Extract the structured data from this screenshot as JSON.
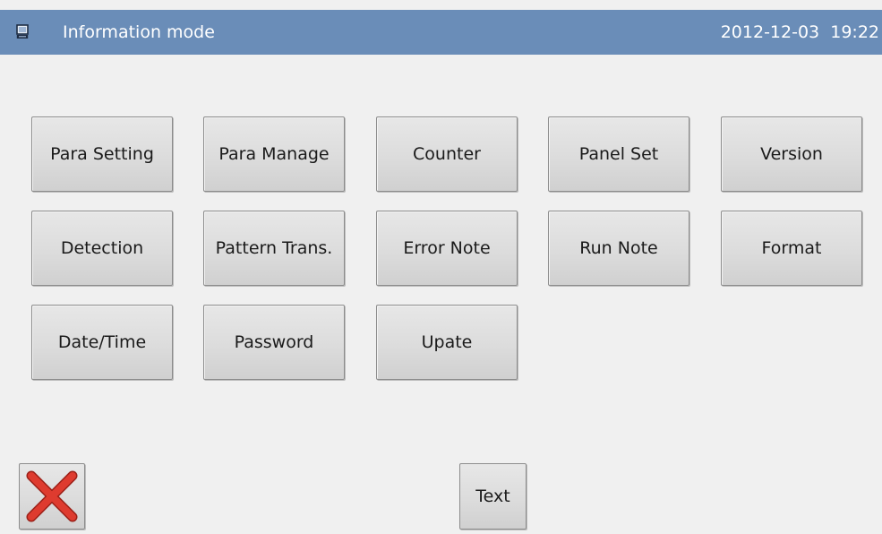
{
  "title_bar": {
    "title": "Information mode",
    "date": "2012-12-03",
    "time": "19:22",
    "icon": "monitor-icon",
    "background_color": "#6a8db8"
  },
  "menu": {
    "buttons": [
      {
        "label": "Para Setting"
      },
      {
        "label": "Para Manage"
      },
      {
        "label": "Counter"
      },
      {
        "label": "Panel Set"
      },
      {
        "label": "Version"
      },
      {
        "label": "Detection"
      },
      {
        "label": "Pattern Trans."
      },
      {
        "label": "Error Note"
      },
      {
        "label": "Run Note"
      },
      {
        "label": "Format"
      },
      {
        "label": "Date/Time"
      },
      {
        "label": "Password"
      },
      {
        "label": "Upate"
      }
    ]
  },
  "footer": {
    "close_icon": "close-icon",
    "close_color": "#d83a2e",
    "text_button_label": "Text"
  }
}
